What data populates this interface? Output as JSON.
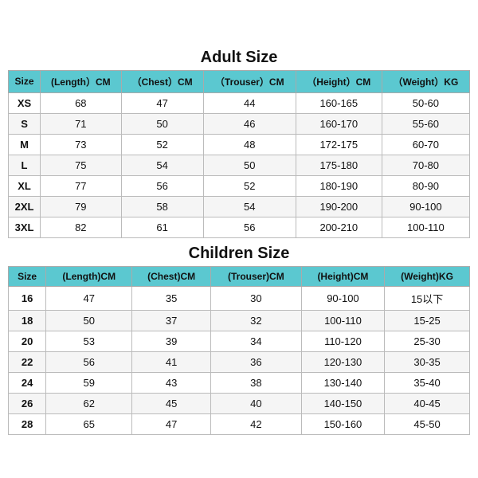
{
  "adult": {
    "title": "Adult Size",
    "headers": [
      "Size",
      "(Length）CM",
      "（Chest）CM",
      "（Trouser）CM",
      "（Height）CM",
      "（Weight）KG"
    ],
    "rows": [
      [
        "XS",
        "68",
        "47",
        "44",
        "160-165",
        "50-60"
      ],
      [
        "S",
        "71",
        "50",
        "46",
        "160-170",
        "55-60"
      ],
      [
        "M",
        "73",
        "52",
        "48",
        "172-175",
        "60-70"
      ],
      [
        "L",
        "75",
        "54",
        "50",
        "175-180",
        "70-80"
      ],
      [
        "XL",
        "77",
        "56",
        "52",
        "180-190",
        "80-90"
      ],
      [
        "2XL",
        "79",
        "58",
        "54",
        "190-200",
        "90-100"
      ],
      [
        "3XL",
        "82",
        "61",
        "56",
        "200-210",
        "100-110"
      ]
    ]
  },
  "children": {
    "title": "Children Size",
    "headers": [
      "Size",
      "(Length)CM",
      "(Chest)CM",
      "(Trouser)CM",
      "(Height)CM",
      "(Weight)KG"
    ],
    "rows": [
      [
        "16",
        "47",
        "35",
        "30",
        "90-100",
        "15以下"
      ],
      [
        "18",
        "50",
        "37",
        "32",
        "100-110",
        "15-25"
      ],
      [
        "20",
        "53",
        "39",
        "34",
        "110-120",
        "25-30"
      ],
      [
        "22",
        "56",
        "41",
        "36",
        "120-130",
        "30-35"
      ],
      [
        "24",
        "59",
        "43",
        "38",
        "130-140",
        "35-40"
      ],
      [
        "26",
        "62",
        "45",
        "40",
        "140-150",
        "40-45"
      ],
      [
        "28",
        "65",
        "47",
        "42",
        "150-160",
        "45-50"
      ]
    ]
  }
}
